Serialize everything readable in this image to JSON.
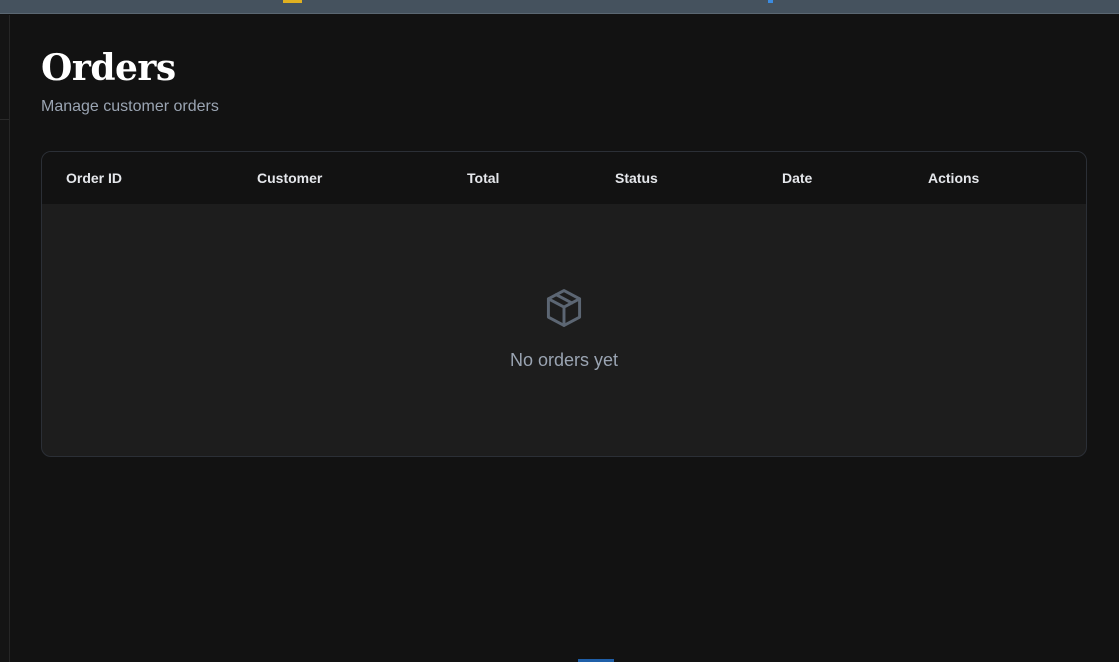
{
  "page": {
    "title": "Orders",
    "subtitle": "Manage customer orders"
  },
  "orders_table": {
    "columns": [
      "Order ID",
      "Customer",
      "Total",
      "Status",
      "Date",
      "Actions"
    ],
    "rows": [],
    "empty_state": {
      "icon": "package-icon",
      "message": "No orders yet"
    }
  },
  "colors": {
    "background": "#121212",
    "card": "#1d1d1d",
    "muted_text": "#9aa4b2",
    "accent": "#1f5fa8"
  }
}
